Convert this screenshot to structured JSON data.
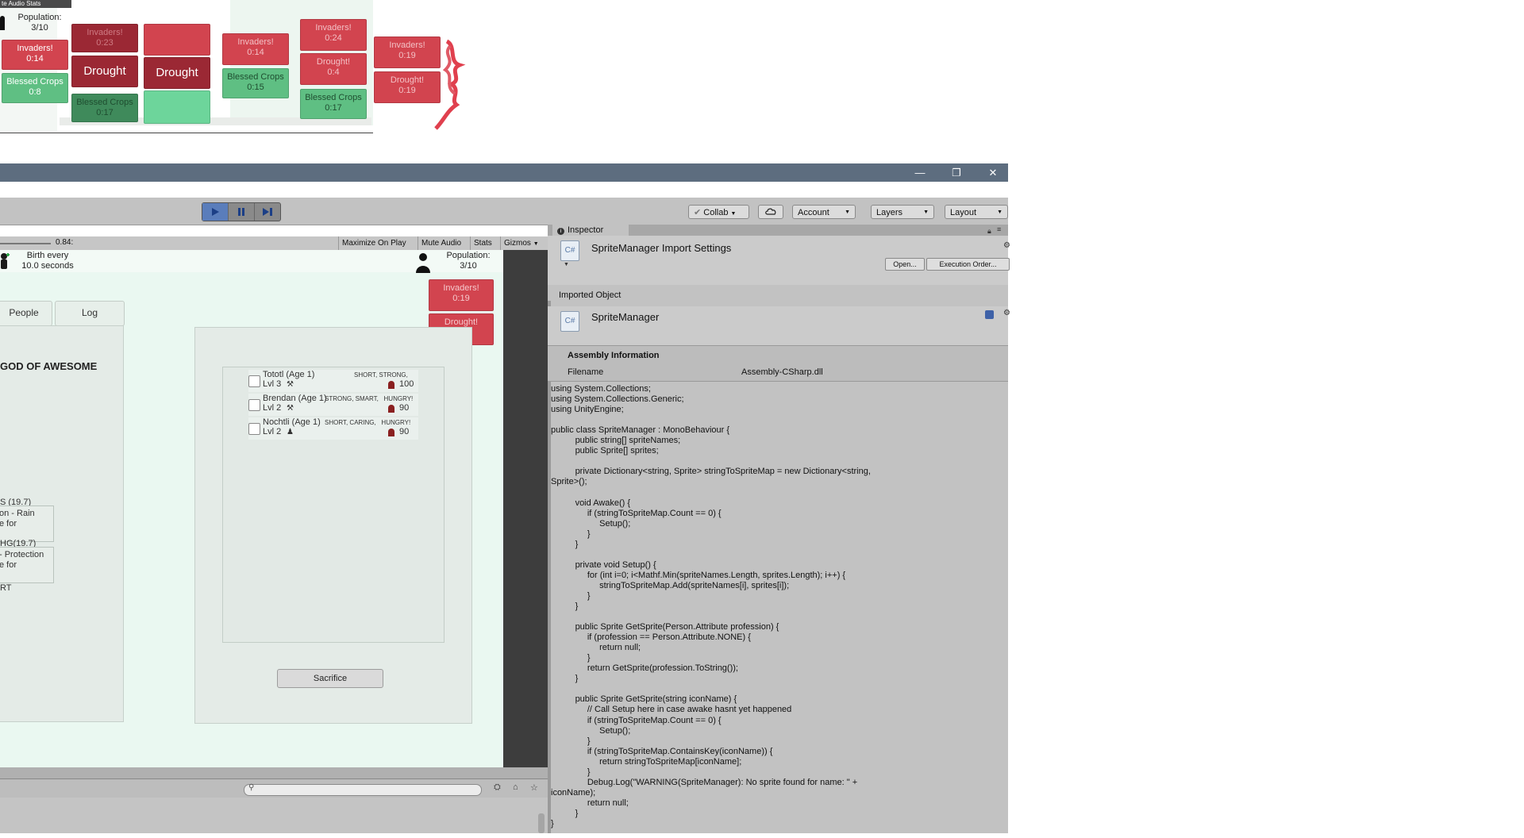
{
  "top_strip": {
    "top_label": "te Audio  Stats",
    "population_label": "Population:",
    "population_value": "3/10",
    "cards": [
      {
        "text": "Invaders!\n0:14"
      },
      {
        "text": "Blessed Crops\n0:8"
      },
      {
        "text": "Invaders!\n0:23"
      },
      {
        "text": "Drought"
      },
      {
        "text": "Blessed Crops\n0:17"
      },
      {
        "text": "Drought"
      },
      {
        "text": "Invaders!\n0:14"
      },
      {
        "text": "Blessed Crops\n0:15"
      },
      {
        "text": "Invaders!\n0:24"
      },
      {
        "text": "Drought!\n0:4"
      },
      {
        "text": "Blessed Crops\n0:17"
      },
      {
        "text": "Invaders!\n0:19"
      },
      {
        "text": "Drought!\n0:19"
      }
    ]
  },
  "window": {
    "minimize": "—",
    "restore": "❐",
    "close": "✕"
  },
  "toolbar": {
    "collab": "Collab",
    "account": "Account",
    "layers": "Layers",
    "layout": "Layout",
    "colors": {
      "play_active": "#5a7dbb"
    }
  },
  "game_view": {
    "scale_value": "0.84:",
    "maximize_on_play": "Maximize On Play",
    "mute_audio": "Mute Audio",
    "stats": "Stats",
    "gizmos": "Gizmos"
  },
  "hud": {
    "birth_line1": "Birth every",
    "birth_line2": "10.0 seconds",
    "population_label": "Population:",
    "population_value": "3/10",
    "events": [
      {
        "text": "Invaders!\n0:19"
      },
      {
        "text": "Drought!\n0:19"
      }
    ]
  },
  "tabs": {
    "people": "People",
    "log": "Log"
  },
  "left_panel": {
    "title": "GOD OF AWESOME",
    "entry1_header": "S (19.7)",
    "entry1_line1": "on - Rain",
    "entry1_line2": "e for",
    "entry2_header": "HG(19.7)",
    "entry2_line1": "- Protection",
    "entry2_line2": "e for",
    "footer": "RT"
  },
  "people": [
    {
      "name": "Tototl (Age 1)",
      "level": "Lvl 3",
      "traits": "SHORT, STRONG,",
      "value": "100"
    },
    {
      "name": "Brendan (Age 1)",
      "level": "Lvl 2",
      "traits": "STRONG, SMART,   HUNGRY!",
      "value": "90"
    },
    {
      "name": "Nochtli (Age 1)",
      "level": "Lvl 2",
      "traits": "SHORT, CARING,   HUNGRY!",
      "value": "90"
    }
  ],
  "sacrifice_button": "Sacrifice",
  "inspector": {
    "tab_label": "Inspector",
    "header_title": "SpriteManager Import Settings",
    "open_button": "Open...",
    "execution_order_button": "Execution Order...",
    "imported_object_label": "Imported Object",
    "object_name": "SpriteManager",
    "assembly_info_label": "Assembly Information",
    "filename_label": "Filename",
    "filename_value": "Assembly-CSharp.dll",
    "script_icon_label": "C#",
    "code": "using System.Collections;\nusing System.Collections.Generic;\nusing UnityEngine;\n\npublic class SpriteManager : MonoBehaviour {\n\t\tpublic string[] spriteNames;\n\t\tpublic Sprite[] sprites;\n\n\t\tprivate Dictionary<string, Sprite> stringToSpriteMap = new Dictionary<string,\nSprite>();\n\n\t\tvoid Awake() {\n\t\t\tif (stringToSpriteMap.Count == 0) {\n\t\t\t\tSetup();\n\t\t\t}\n\t\t}\n\n\t\tprivate void Setup() {\n\t\t\tfor (int i=0; i<Mathf.Min(spriteNames.Length, sprites.Length); i++) {\n\t\t\t\tstringToSpriteMap.Add(spriteNames[i], sprites[i]);\n\t\t\t}\n\t\t}\n\n\t\tpublic Sprite GetSprite(Person.Attribute profession) {\n\t\t\tif (profession == Person.Attribute.NONE) {\n\t\t\t\treturn null;\n\t\t\t}\n\t\t\treturn GetSprite(profession.ToString());\n\t\t}\n\n\t\tpublic Sprite GetSprite(string iconName) {\n\t\t\t// Call Setup here in case awake hasnt yet happened\n\t\t\tif (stringToSpriteMap.Count == 0) {\n\t\t\t\tSetup();\n\t\t\t}\n\t\t\tif (stringToSpriteMap.ContainsKey(iconName)) {\n\t\t\t\treturn stringToSpriteMap[iconName];\n\t\t\t}\n\t\t\tDebug.Log(\"WARNING(SpriteManager): No sprite found for name: \" +\niconName);\n\t\t\treturn null;\n\t\t}\n}"
  }
}
